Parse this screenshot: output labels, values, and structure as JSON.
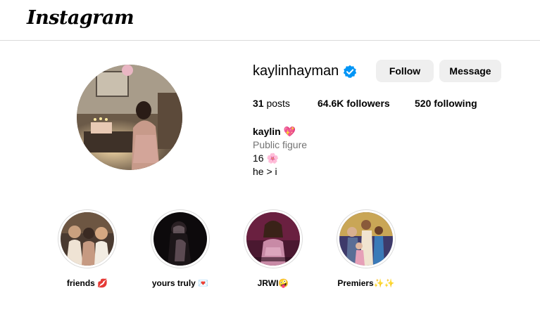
{
  "app": {
    "logo": "Instagram"
  },
  "profile": {
    "username": "kaylinhayman",
    "verified": true,
    "buttons": {
      "follow": "Follow",
      "message": "Message"
    },
    "stats": {
      "posts_count": "31",
      "posts_label": "posts",
      "followers_count": "64.6K",
      "followers_label": "followers",
      "following_count": "520",
      "following_label": "following"
    },
    "bio": {
      "name": "kaylin 💖",
      "category": "Public figure",
      "line1": "16 🌸",
      "line2": "he > i"
    }
  },
  "highlights": [
    {
      "label": "friends 💋"
    },
    {
      "label": "yours truly 💌"
    },
    {
      "label": "JRWI🤪"
    },
    {
      "label": "Premiers✨✨"
    }
  ],
  "colors": {
    "verified_blue": "#0095f6",
    "button_bg": "#efefef",
    "secondary_text": "#737373",
    "divider": "#dbdbdb"
  }
}
